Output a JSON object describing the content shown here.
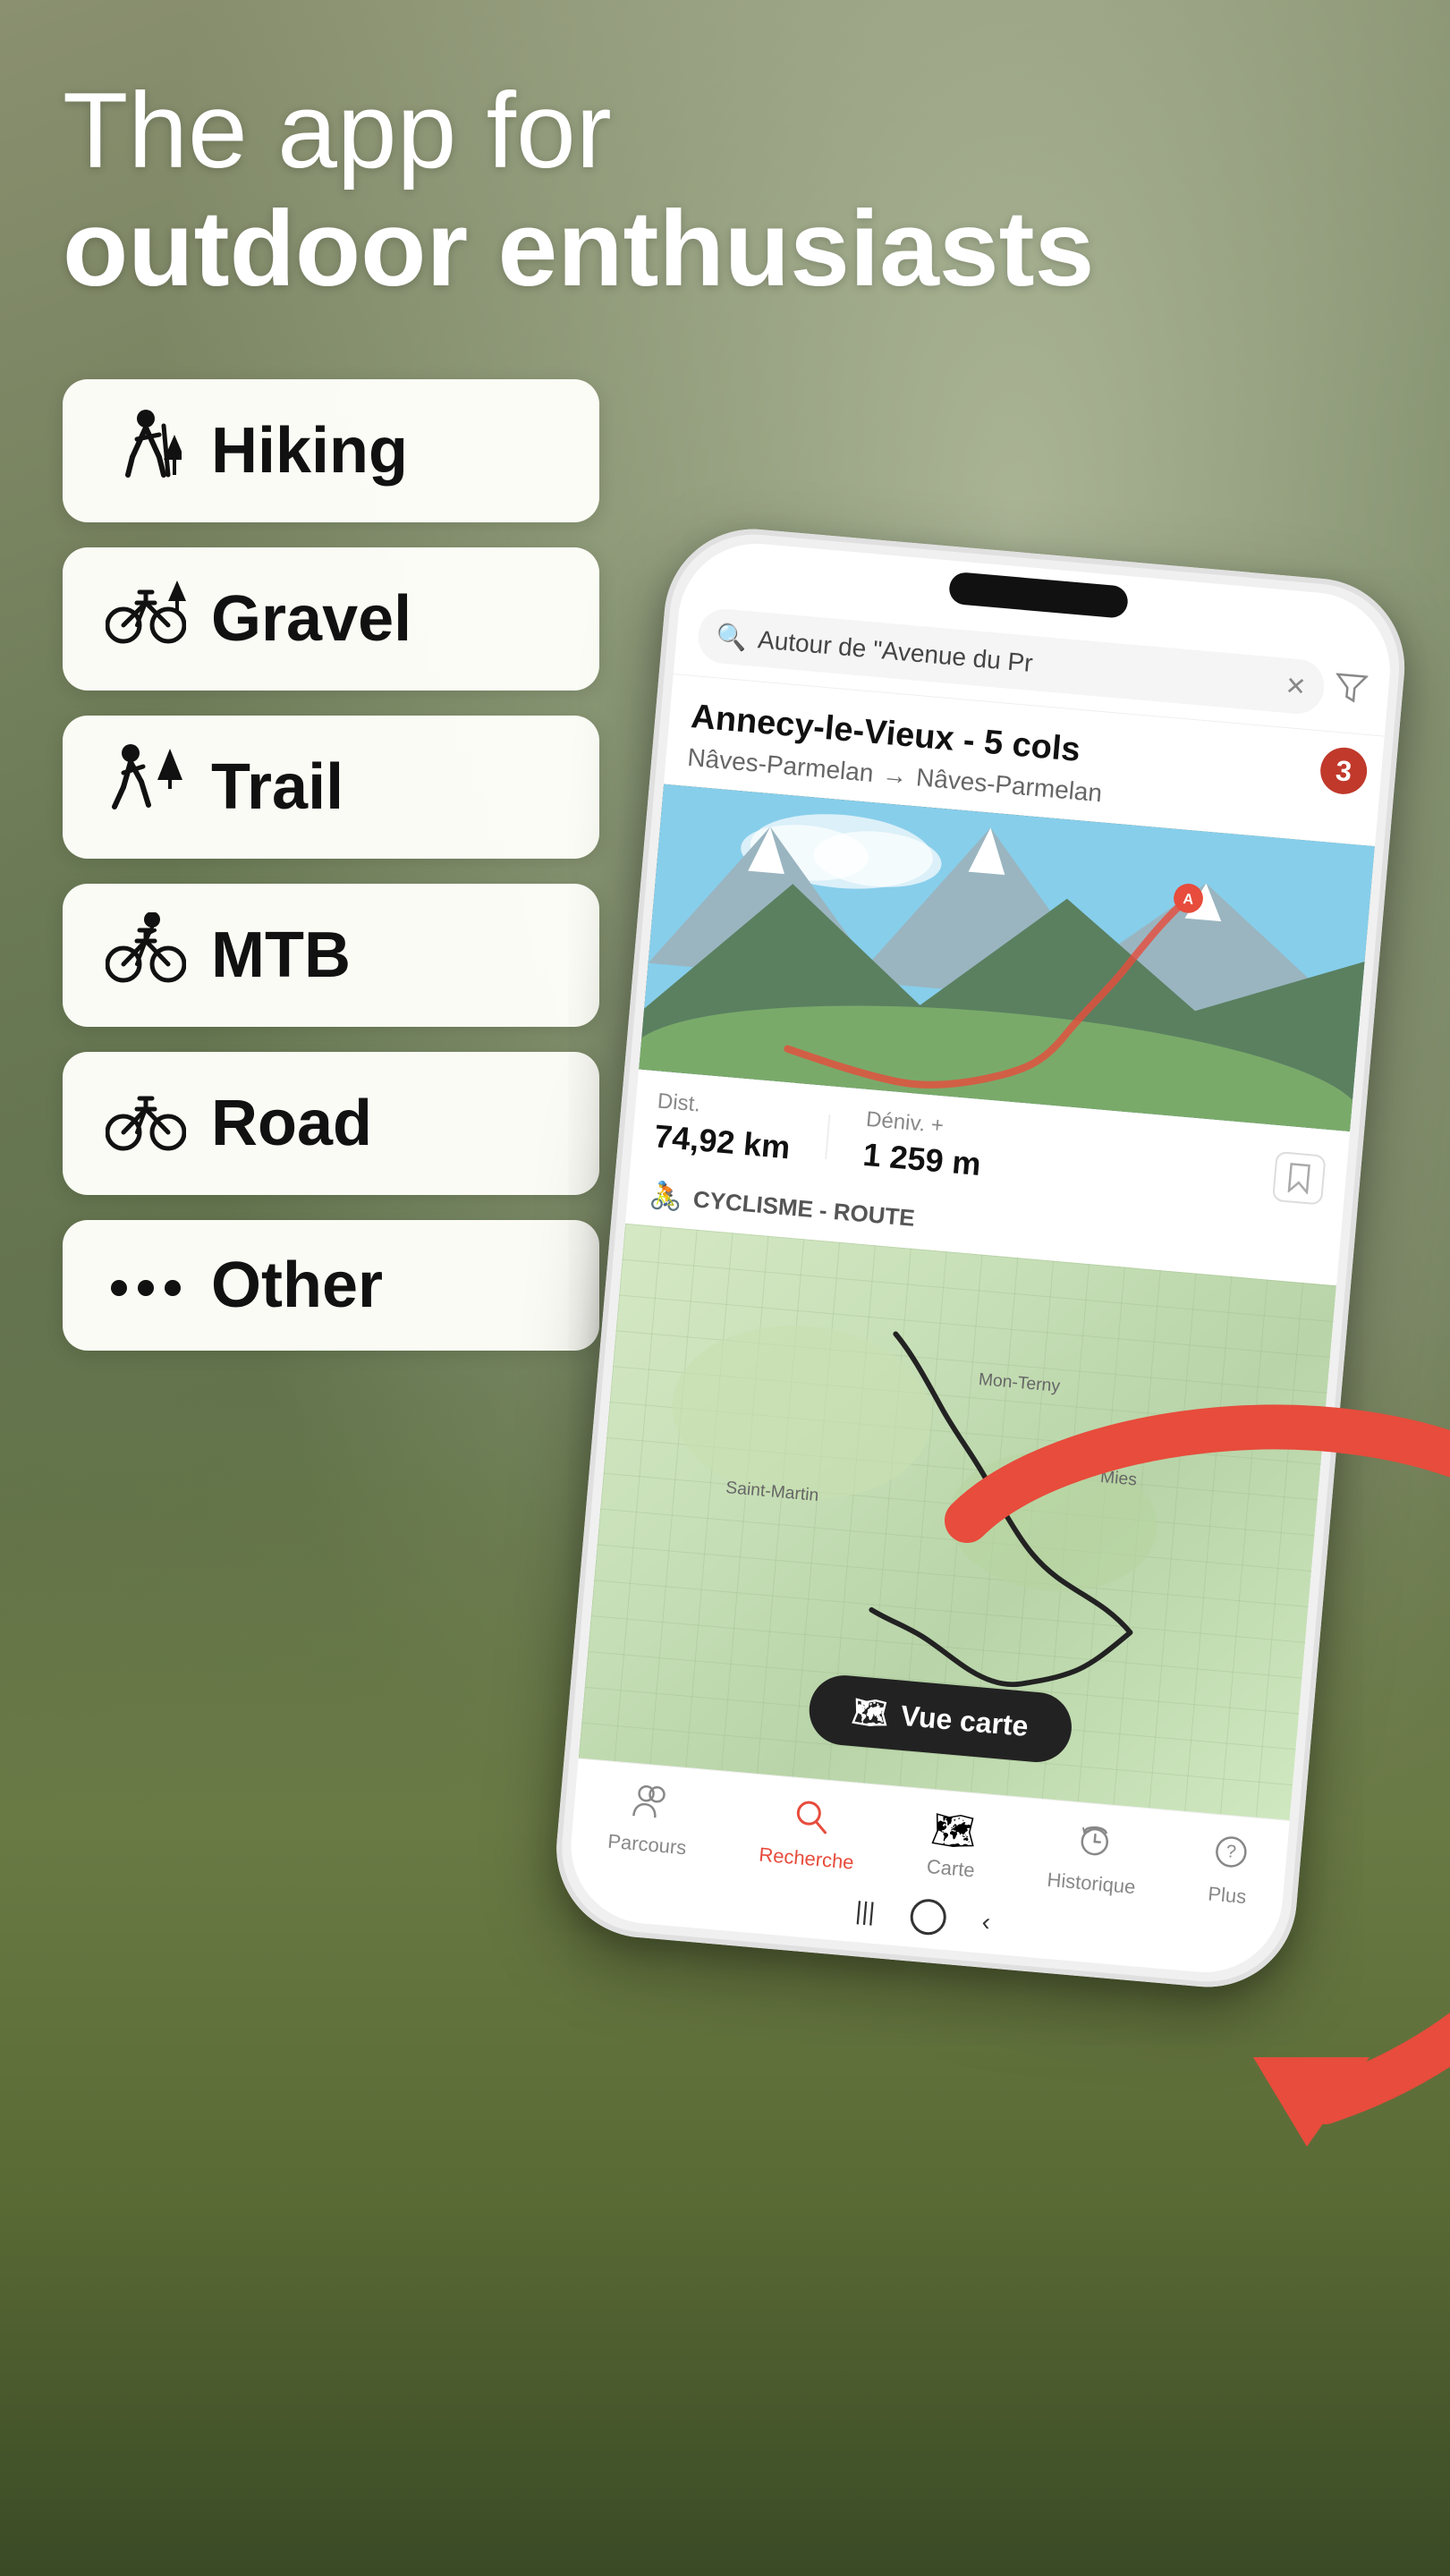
{
  "hero": {
    "title_part1": "The app for ",
    "title_bold": "outdoor enthusiasts"
  },
  "categories": [
    {
      "id": "hiking",
      "label": "Hiking",
      "icon": "🚶",
      "icon_name": "hiking-icon"
    },
    {
      "id": "gravel",
      "label": "Gravel",
      "icon": "🚲",
      "icon_name": "gravel-icon"
    },
    {
      "id": "trail",
      "label": "Trail",
      "icon": "🏃",
      "icon_name": "trail-icon"
    },
    {
      "id": "mtb",
      "label": "MTB",
      "icon": "🚵",
      "icon_name": "mtb-icon"
    },
    {
      "id": "road",
      "label": "Road",
      "icon": "🚴",
      "icon_name": "road-icon"
    },
    {
      "id": "other",
      "label": "Other",
      "icon": "•••",
      "icon_name": "other-icon"
    }
  ],
  "phone": {
    "search_text": "Autour de \"Avenue du Pr",
    "route": {
      "badge": "3",
      "title": "Annecy-le-Vieux - 5 cols",
      "subtitle_from": "Nâves-Parmelan",
      "subtitle_to": "Nâves-Parmelan",
      "arrow": "→",
      "distance_label": "Dist.",
      "distance_value": "74,92 km",
      "elevation_label": "Déniv. +",
      "elevation_value": "1 259 m",
      "type_icon": "🚴",
      "type_label": "CYCLISME - ROUTE"
    },
    "map_button": "Vue carte",
    "nav_items": [
      {
        "id": "parcours",
        "label": "Parcours",
        "icon": "👥",
        "active": false
      },
      {
        "id": "recherche",
        "label": "Recherche",
        "icon": "🔍",
        "active": true
      },
      {
        "id": "carte",
        "label": "Carte",
        "icon": "🗺",
        "active": false
      },
      {
        "id": "historique",
        "label": "Historique",
        "icon": "🕒",
        "active": false
      },
      {
        "id": "plus",
        "label": "Plus",
        "icon": "⊕",
        "active": false
      }
    ]
  },
  "colors": {
    "accent": "#e74c3c",
    "bg_primary": "#6b7a5a",
    "card_bg": "#ffffff",
    "text_primary": "#111111",
    "text_secondary": "#666666"
  }
}
